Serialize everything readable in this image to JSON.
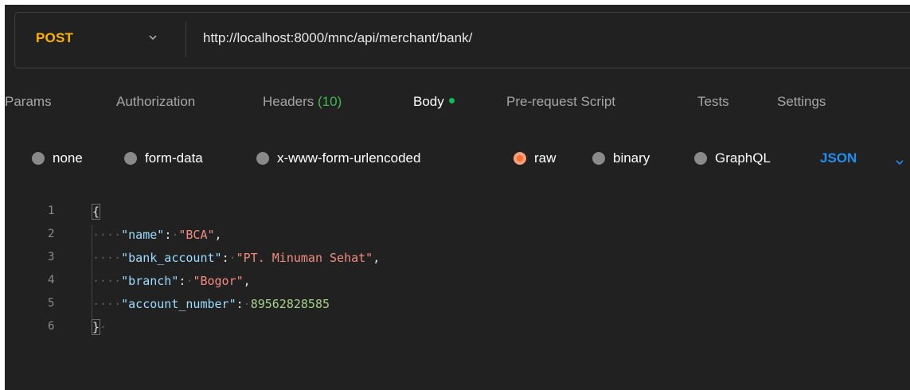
{
  "request": {
    "method": "POST",
    "url": "http://localhost:8000/mnc/api/merchant/bank/"
  },
  "tabs": [
    {
      "label": "Params"
    },
    {
      "label": "Authorization"
    },
    {
      "label": "Headers",
      "count": "(10)"
    },
    {
      "label": "Body",
      "active": true
    },
    {
      "label": "Pre-request Script"
    },
    {
      "label": "Tests"
    },
    {
      "label": "Settings"
    }
  ],
  "body_types": [
    {
      "label": "none"
    },
    {
      "label": "form-data"
    },
    {
      "label": "x-www-form-urlencoded"
    },
    {
      "label": "raw",
      "selected": true
    },
    {
      "label": "binary"
    },
    {
      "label": "GraphQL"
    }
  ],
  "language": "JSON",
  "editor": {
    "line_numbers": [
      "1",
      "2",
      "3",
      "4",
      "5",
      "6"
    ],
    "open_brace": "{",
    "close_brace": "}",
    "fields": [
      {
        "key": "\"name\"",
        "value": "\"BCA\"",
        "type": "string"
      },
      {
        "key": "\"bank_account\"",
        "value": "\"PT. Minuman Sehat\"",
        "type": "string"
      },
      {
        "key": "\"branch\"",
        "value": "\"Bogor\"",
        "type": "string"
      },
      {
        "key": "\"account_number\"",
        "value": "89562828585",
        "type": "number"
      }
    ]
  },
  "colors": {
    "background": "#212121",
    "method": "#ffb400",
    "active_dot": "#0cbb52",
    "selected_radio": "#ff6c37",
    "language": "#1f8ef1"
  }
}
